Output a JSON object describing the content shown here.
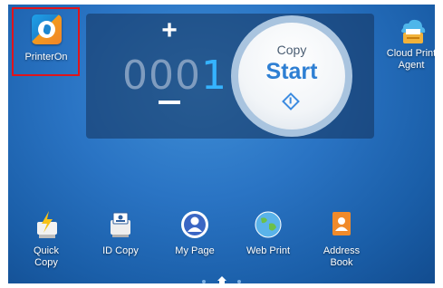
{
  "apps": {
    "printeron": {
      "label": "PrinterOn",
      "icon": "printeron-icon"
    },
    "cloud_print": {
      "label_line1": "Cloud Print",
      "label_line2": "Agent",
      "icon": "cloud-print-icon"
    }
  },
  "copy_panel": {
    "plus": "+",
    "counter_zeros": "000",
    "counter_digit": "1",
    "start_top": "Copy",
    "start_main": "Start"
  },
  "dock": [
    {
      "line1": "Quick",
      "line2": "Copy",
      "icon": "quick-copy-icon"
    },
    {
      "line1": "ID Copy",
      "line2": "",
      "icon": "id-copy-icon"
    },
    {
      "line1": "My Page",
      "line2": "",
      "icon": "my-page-icon"
    },
    {
      "line1": "Web Print",
      "line2": "",
      "icon": "web-print-icon"
    },
    {
      "line1": "Address",
      "line2": "Book",
      "icon": "address-book-icon"
    }
  ],
  "colors": {
    "background": "#2a74c4",
    "counter_accent": "#35b3ff",
    "highlight_box": "#e0141b"
  }
}
